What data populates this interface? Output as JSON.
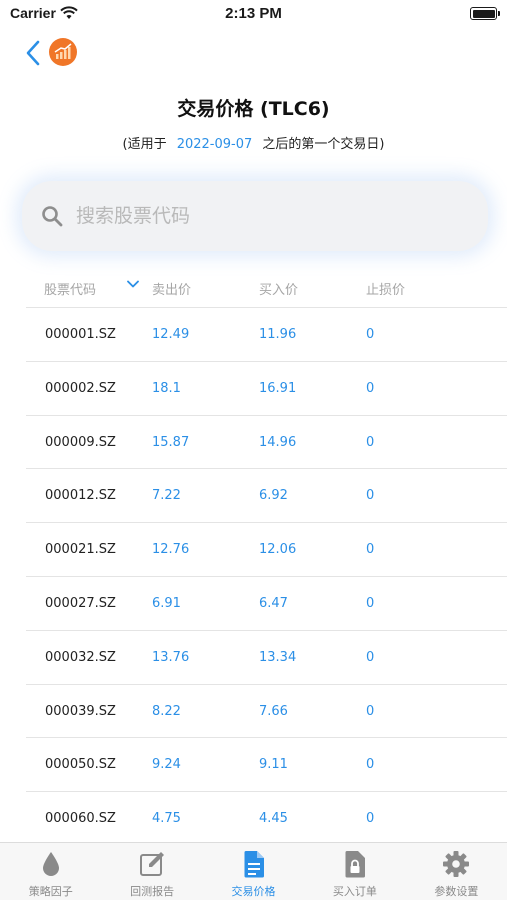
{
  "status_bar": {
    "carrier": "Carrier",
    "time": "2:13 PM"
  },
  "header": {
    "title": "交易价格 (TLC6)",
    "subtitle_prefix": "(适用于",
    "subtitle_date": "2022-09-07",
    "subtitle_suffix": "之后的第一个交易日)"
  },
  "search": {
    "placeholder": "搜索股票代码",
    "value": ""
  },
  "table": {
    "headers": {
      "code": "股票代码",
      "sell": "卖出价",
      "buy": "买入价",
      "stop": "止损价"
    },
    "rows": [
      {
        "code": "000001.SZ",
        "sell": "12.49",
        "buy": "11.96",
        "stop": "0"
      },
      {
        "code": "000002.SZ",
        "sell": "18.1",
        "buy": "16.91",
        "stop": "0"
      },
      {
        "code": "000009.SZ",
        "sell": "15.87",
        "buy": "14.96",
        "stop": "0"
      },
      {
        "code": "000012.SZ",
        "sell": "7.22",
        "buy": "6.92",
        "stop": "0"
      },
      {
        "code": "000021.SZ",
        "sell": "12.76",
        "buy": "12.06",
        "stop": "0"
      },
      {
        "code": "000027.SZ",
        "sell": "6.91",
        "buy": "6.47",
        "stop": "0"
      },
      {
        "code": "000032.SZ",
        "sell": "13.76",
        "buy": "13.34",
        "stop": "0"
      },
      {
        "code": "000039.SZ",
        "sell": "8.22",
        "buy": "7.66",
        "stop": "0"
      },
      {
        "code": "000050.SZ",
        "sell": "9.24",
        "buy": "9.11",
        "stop": "0"
      },
      {
        "code": "000060.SZ",
        "sell": "4.75",
        "buy": "4.45",
        "stop": "0"
      }
    ]
  },
  "tabs": [
    {
      "label": "策略因子",
      "icon": "drop-icon"
    },
    {
      "label": "回测报告",
      "icon": "edit-icon"
    },
    {
      "label": "交易价格",
      "icon": "document-icon"
    },
    {
      "label": "买入订单",
      "icon": "lock-document-icon"
    },
    {
      "label": "参数设置",
      "icon": "gear-icon"
    }
  ],
  "colors": {
    "accent": "#2b8fe6",
    "logo": "#f07628",
    "muted": "#a6a6a6"
  }
}
